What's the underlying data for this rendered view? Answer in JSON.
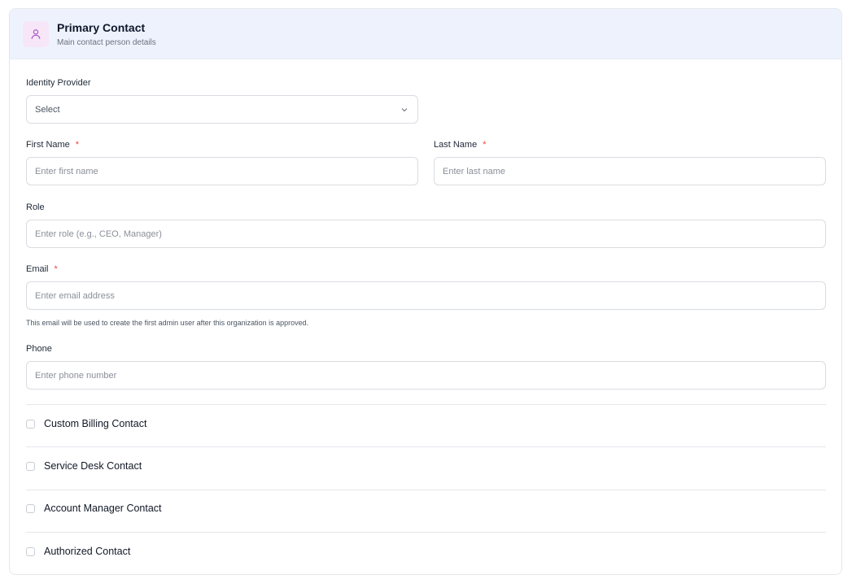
{
  "section": {
    "title": "Primary Contact",
    "subtitle": "Main contact person details",
    "icon": "user-icon",
    "accent_color": "#a855c7"
  },
  "fields": {
    "identity_provider": {
      "label": "Identity Provider",
      "value": "Select"
    },
    "first_name": {
      "label": "First Name",
      "required_mark": "*",
      "placeholder": "Enter first name"
    },
    "last_name": {
      "label": "Last Name",
      "required_mark": "*",
      "placeholder": "Enter last name"
    },
    "role": {
      "label": "Role",
      "placeholder": "Enter role (e.g., CEO, Manager)"
    },
    "email": {
      "label": "Email",
      "required_mark": "*",
      "placeholder": "Enter email address",
      "helper": "This email will be used to create the first admin user after this organization is approved."
    },
    "phone": {
      "label": "Phone",
      "placeholder": "Enter phone number"
    }
  },
  "options": [
    {
      "label": "Custom Billing Contact",
      "checked": false
    },
    {
      "label": "Service Desk Contact",
      "checked": false
    },
    {
      "label": "Account Manager Contact",
      "checked": false
    },
    {
      "label": "Authorized Contact",
      "checked": false
    }
  ],
  "colors": {
    "header_bg": "#eef2fd",
    "required": "#ef4444",
    "border": "#d9dce1"
  }
}
